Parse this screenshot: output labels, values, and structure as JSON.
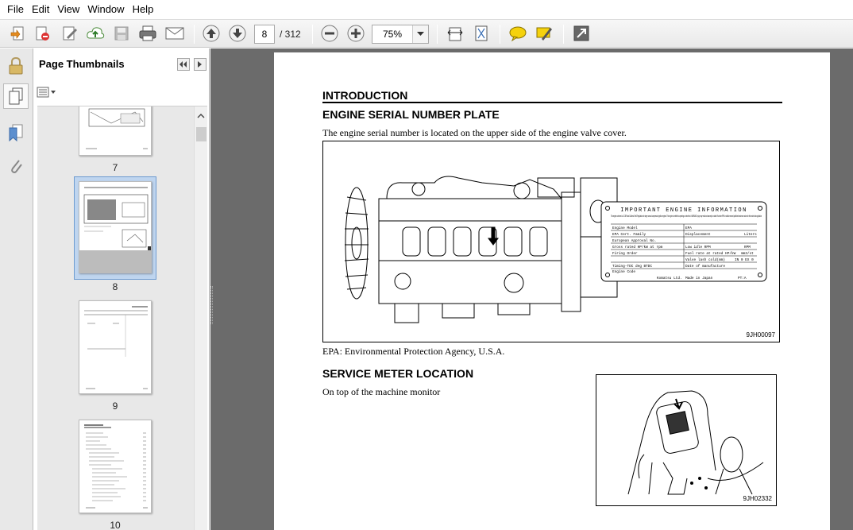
{
  "menu": [
    "File",
    "Edit",
    "View",
    "Window",
    "Help"
  ],
  "toolbar": {
    "page_current": "8",
    "page_total": "/ 312",
    "zoom": "75%",
    "icons": [
      "create-icon",
      "properties-icon",
      "edit-icon",
      "upload-icon",
      "save-icon",
      "print-icon",
      "email-icon",
      "prev-page-icon",
      "next-page-icon",
      "zoom-out-icon",
      "zoom-in-icon",
      "fit-width-icon",
      "fit-page-icon",
      "comment-icon",
      "sign-icon",
      "expand-icon"
    ]
  },
  "panel": {
    "title": "Page Thumbnails",
    "thumbs": [
      {
        "label": "7"
      },
      {
        "label": "8",
        "selected": true
      },
      {
        "label": "9"
      },
      {
        "label": "10"
      }
    ]
  },
  "doc": {
    "title": "INTRODUCTION",
    "section1_title": "ENGINE SERIAL NUMBER PLATE",
    "section1_text": "The engine serial number is located on the upper side of the engine valve cover.",
    "fig1_code": "9JH00097",
    "epa_note": "EPA: Environmental Protection Agency, U.S.A.",
    "section2_title": "SERVICE METER LOCATION",
    "section2_text": "On top of the machine monitor",
    "fig2_code": "9JH02332",
    "plate": {
      "title": "IMPORTANT ENGINE INFORMATION",
      "intro": "This engine conforms to U.S.EPA and California Tier3 Regulations for large nonroad compression ignition engines. This engine is certified to operating on diesel fuel. WARNING: Injury may result and warranty is voided if fuel rate RPM or altitude exceed published maximum values for this model and application",
      "rows": [
        [
          "Engine Model",
          "EPA"
        ],
        [
          "EPA Cert. Family",
          "Displacement",
          "Liters"
        ],
        [
          "European Approval No."
        ],
        [
          "Gross rated HP/kW at rpm",
          "Low idle RPM",
          "RPM"
        ],
        [
          "Firing Order",
          "Fuel rate at rated HP/kW",
          "mm3/st"
        ],
        [
          "",
          "Valve lash cold(mm)",
          "IN 0  EX 0"
        ],
        [
          "Timing-TDC deg BTDC",
          "Date of manufacture"
        ],
        [
          "Engine Code"
        ]
      ],
      "footer_maker": "Komatsu Ltd.",
      "footer_origin": "Made in Japan",
      "footer_code": "PT:A"
    }
  }
}
